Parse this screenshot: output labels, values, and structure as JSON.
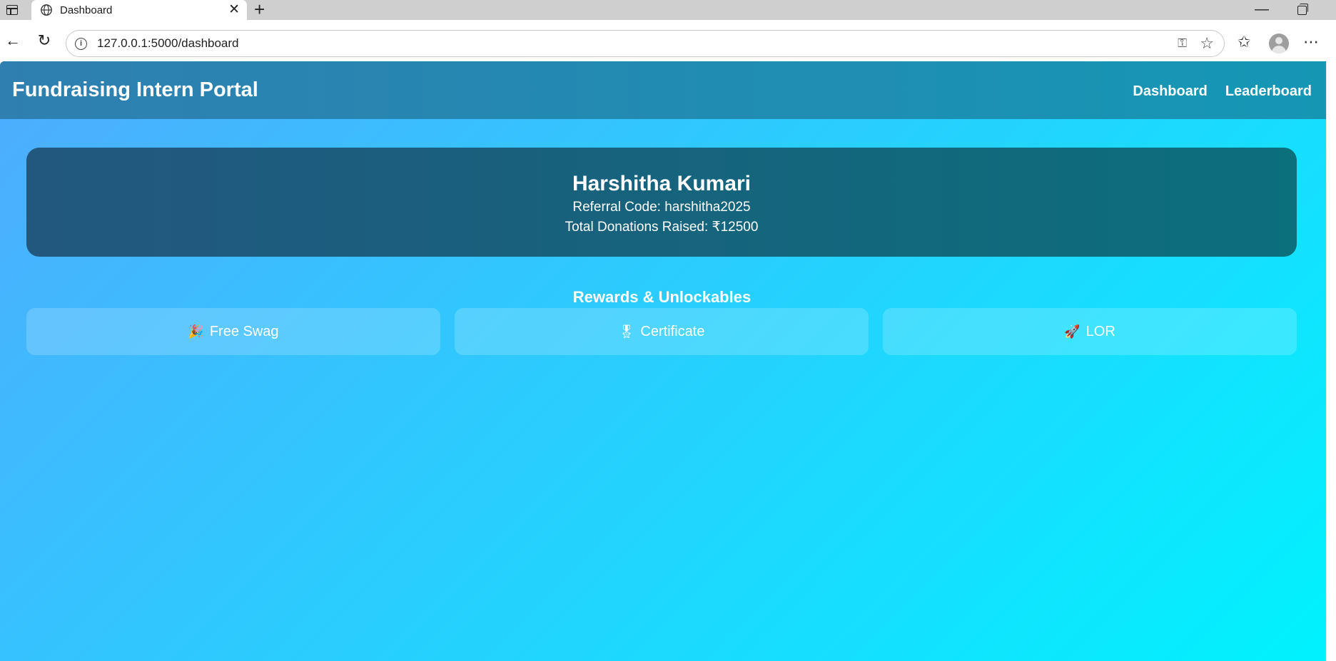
{
  "browser": {
    "tab_title": "Dashboard",
    "url": "127.0.0.1:5000/dashboard",
    "icons": {
      "sidebar": "sidebar-icon",
      "tab_favicon": "globe-icon",
      "tab_close": "close-icon",
      "new_tab": "plus-icon",
      "back": "back-arrow-icon",
      "reload": "reload-icon",
      "site_info": "info-icon",
      "password": "key-icon",
      "favorite": "star-icon",
      "favorites_list": "favorites-icon",
      "profile": "avatar-icon",
      "menu": "more-icon",
      "minimize": "minimize-icon",
      "restore": "restore-icon"
    }
  },
  "site": {
    "title": "Fundraising Intern Portal",
    "nav": [
      "Dashboard",
      "Leaderboard"
    ]
  },
  "profile": {
    "name": "Harshitha Kumari",
    "referral_line": "Referral Code: harshitha2025",
    "donations_line": "Total Donations Raised: ₹12500"
  },
  "rewards": {
    "title": "Rewards & Unlockables",
    "items": [
      {
        "emoji": "🎉",
        "label": "Free Swag"
      },
      {
        "emoji": "🎖",
        "label": "Certificate"
      },
      {
        "emoji": "🚀",
        "label": "LOR"
      }
    ]
  },
  "colors": {
    "page_gradient_start": "#4facfe",
    "page_gradient_end": "#00f2fe",
    "header_start": "#2f7fb0",
    "header_end": "#1597b4",
    "card_start": "#22577e",
    "card_end": "#0b6f7c"
  }
}
